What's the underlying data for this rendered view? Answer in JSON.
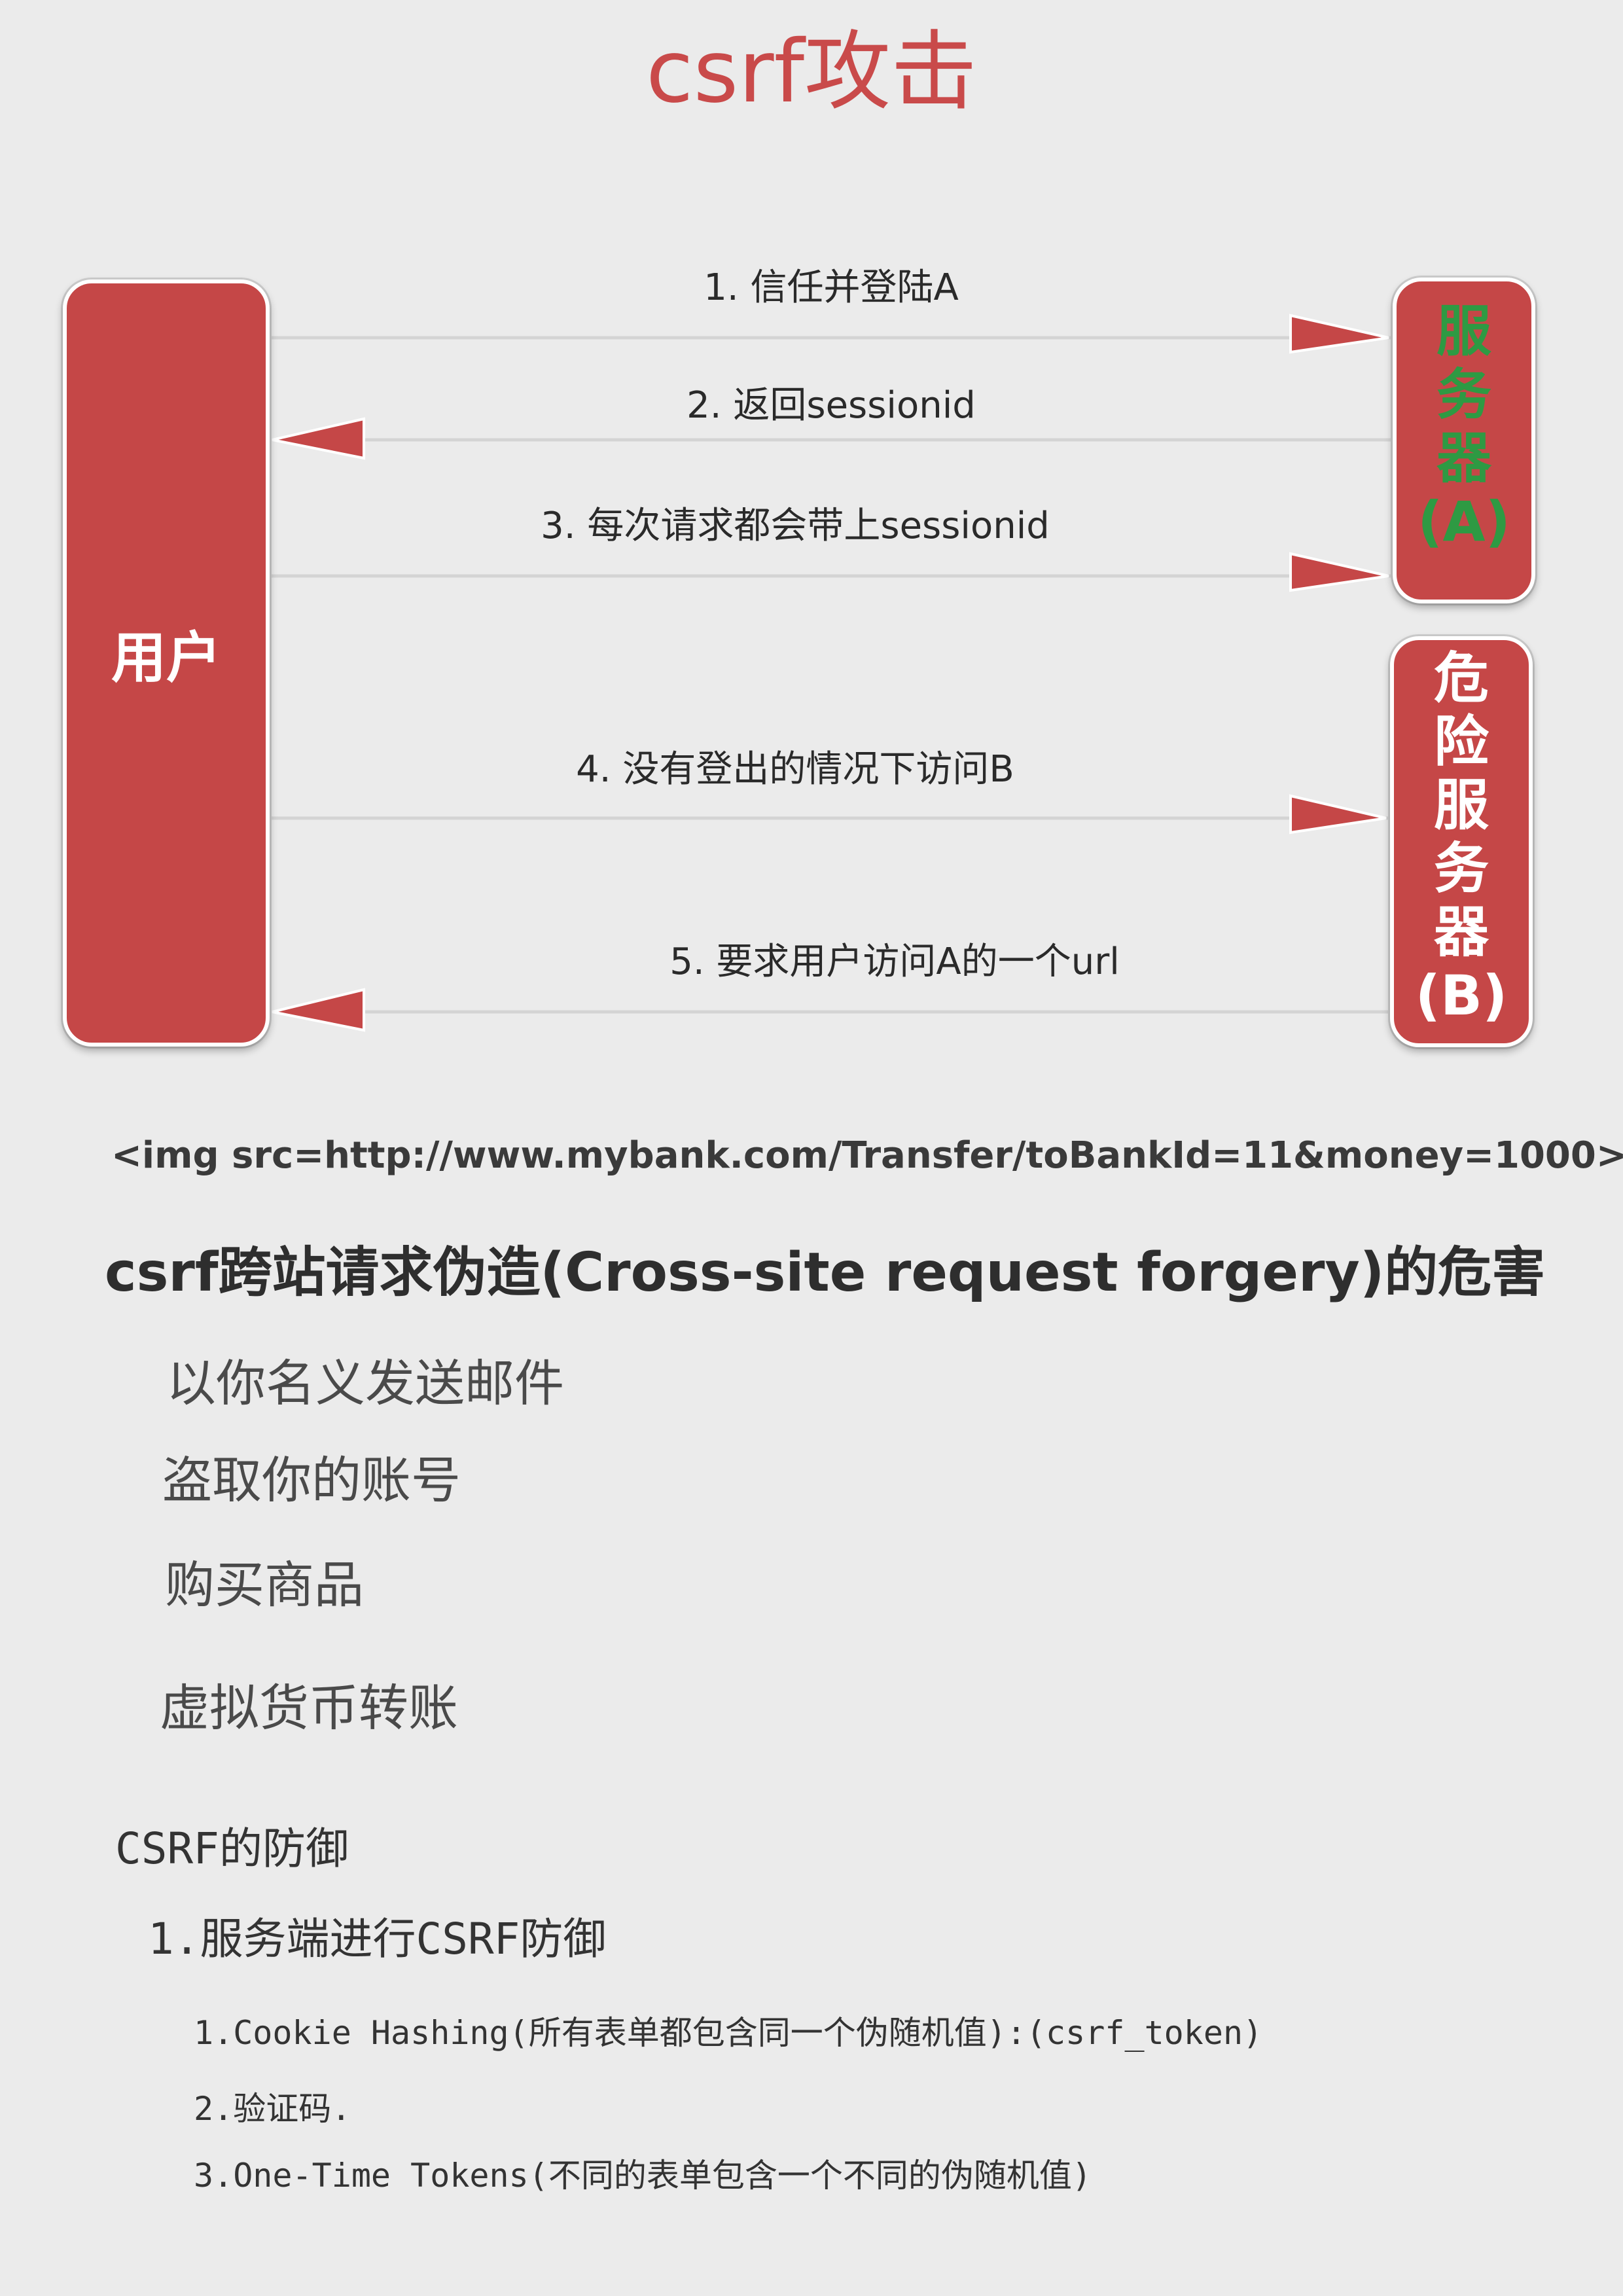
{
  "title": "csrf攻击",
  "diagram": {
    "user": "用户",
    "server_a": [
      "服",
      "务",
      "器",
      "(A)"
    ],
    "server_b": [
      "危",
      "险",
      "服",
      "务",
      "器",
      "(B)"
    ],
    "steps": [
      "1. 信任并登陆A",
      "2. 返回sessionid",
      "3. 每次请求都会带上sessionid",
      "4. 没有登出的情况下访问B",
      "5. 要求用户访问A的一个url"
    ],
    "colors": {
      "box": "#c54747",
      "server_a_text": "#2e9a43",
      "arrow": "#c54747"
    }
  },
  "img_tag": "<img src=http://www.mybank.com/Transfer/toBankId=11&money=1000>",
  "harm": {
    "heading": "csrf跨站请求伪造(Cross-site request forgery)的危害",
    "items": [
      "以你名义发送邮件",
      "盗取你的账号",
      "购买商品",
      "虚拟货币转账"
    ]
  },
  "defense": {
    "heading": "CSRF的防御",
    "sub": "1.服务端进行CSRF防御",
    "items": [
      "1.Cookie Hashing(所有表单都包含同一个伪随机值):(csrf_token)",
      "2.验证码.",
      "3.One-Time Tokens(不同的表单包含一个不同的伪随机值)"
    ]
  }
}
